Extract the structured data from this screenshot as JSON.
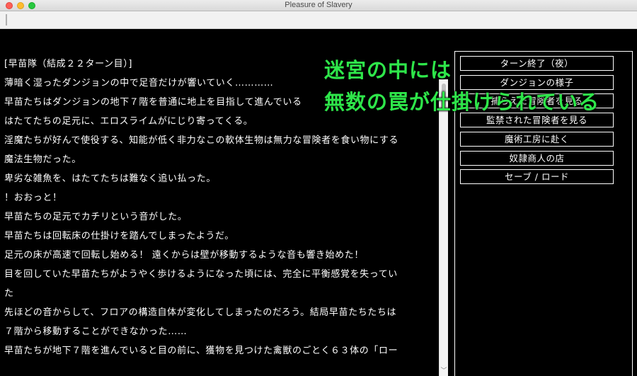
{
  "window": {
    "title": "Pleasure of Slavery"
  },
  "log": {
    "lines": [
      "[早苗隊（結成２２ターン目）]",
      "薄暗く湿ったダンジョンの中で足音だけが響いていく…………",
      "早苗たちはダンジョンの地下７階を普通に地上を目指して進んでいる",
      "はたてたちの足元に、エロスライムがにじり寄ってくる。",
      "淫魔たちが好んで使役する、知能が低く非力なこの軟体生物は無力な冒険者を食い物にする",
      "魔法生物だった。",
      "卑劣な雑魚を、はたてたちは難なく追い払った。",
      "！おおっと！",
      "早苗たちの足元でカチリという音がした。",
      "早苗たちは回転床の仕掛けを踏んでしまったようだ。",
      "足元の床が高速で回転し始める！ 遠くからは壁が移動するような音も響き始めた！",
      "目を回していた早苗たちがようやく歩けるようになった頃には、完全に平衡感覚を失ってい",
      "た",
      "先ほどの音からして、フロアの構造自体が変化してしまったのだろう。結局早苗たちたちは",
      "７階から移動することができなかった……",
      "早苗たちが地下７階を進んでいると目の前に、獲物を見つけた禽獣のごとく６３体の「ロー"
    ]
  },
  "menu": {
    "items": [
      "ターン終了（夜）",
      "ダンジョンの様子",
      "捕らえた冒険者を見る",
      "監禁された冒険者を見る",
      "魔術工房に赴く",
      "奴隷商人の店",
      "セーブ / ロード"
    ]
  },
  "overlay": {
    "line1": "迷宮の中には",
    "line2": "無数の罠が仕掛けられている"
  },
  "scrollbar": {
    "arrow": "﹀"
  },
  "colors": {
    "overlay_text": "#2ee64a",
    "background": "#000000",
    "text": "#ffffff"
  }
}
